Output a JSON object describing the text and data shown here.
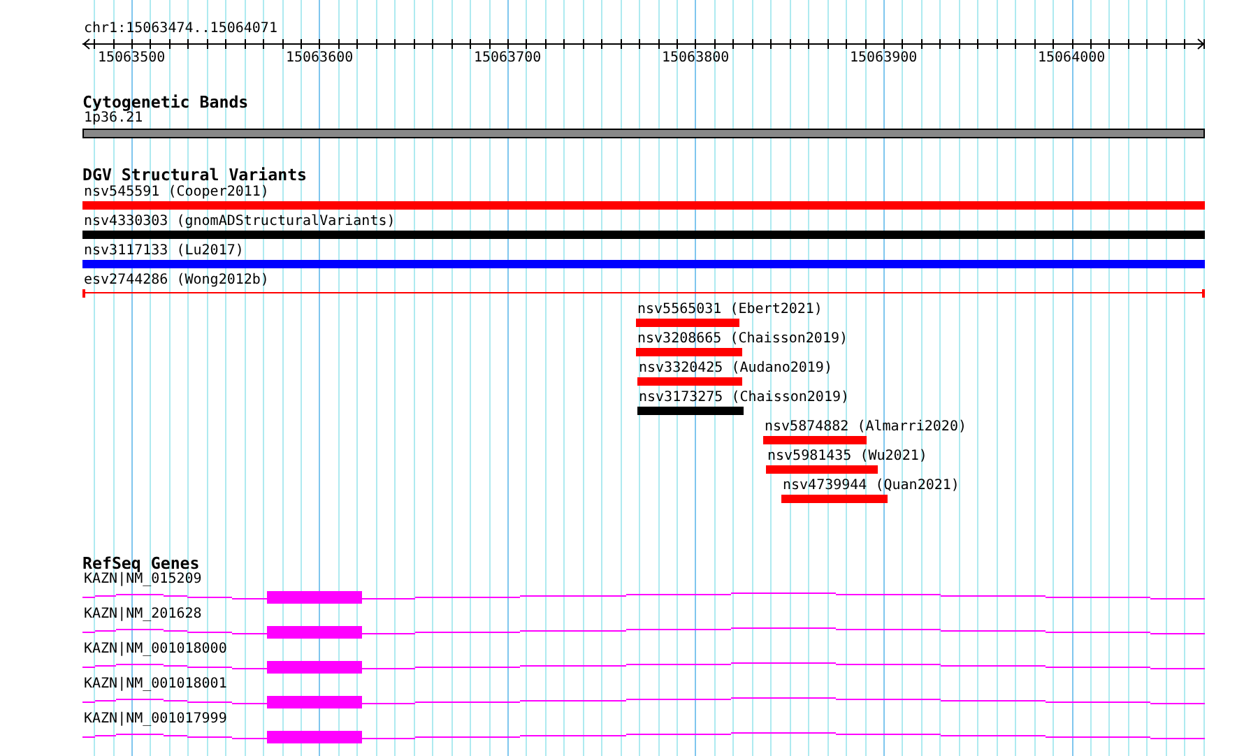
{
  "ruler": {
    "range": "chr1:15063474..15064071",
    "ticks": [
      "15063500",
      "15063600",
      "15063700",
      "15063800",
      "15063900",
      "15064000"
    ]
  },
  "tracks": [
    {
      "kind": "bands",
      "title": "Cytogenetic Bands",
      "features": [
        {
          "label": "1p36.21"
        }
      ]
    },
    {
      "kind": "variants",
      "title": "DGV Structural Variants",
      "features": [
        {
          "label": "nsv545591 (Cooper2011)",
          "kind": "bar",
          "color": "#ff0000"
        },
        {
          "label": "nsv4330303 (gnomADStructuralVariants)",
          "kind": "bar",
          "color": "#000000"
        },
        {
          "label": "nsv3117133 (Lu2017)",
          "kind": "bar",
          "color": "#0000ff"
        },
        {
          "label": "esv2744286 (Wong2012b)",
          "kind": "line",
          "color": "#ff0000"
        },
        {
          "label": "nsv5565031 (Ebert2021)",
          "kind": "bar",
          "color": "#ff0000"
        },
        {
          "label": "nsv3208665 (Chaisson2019)",
          "kind": "bar",
          "color": "#ff0000"
        },
        {
          "label": "nsv3320425 (Audano2019)",
          "kind": "bar",
          "color": "#ff0000"
        },
        {
          "label": "nsv3173275 (Chaisson2019)",
          "kind": "bar",
          "color": "#000000"
        },
        {
          "label": "nsv5874882 (Almarri2020)",
          "kind": "bar",
          "color": "#ff0000"
        },
        {
          "label": "nsv5981435 (Wu2021)",
          "kind": "bar",
          "color": "#ff0000"
        },
        {
          "label": "nsv4739944 (Quan2021)",
          "kind": "bar",
          "color": "#ff0000"
        }
      ]
    },
    {
      "kind": "genes",
      "title": "RefSeq Genes",
      "features": [
        {
          "label": "KAZN|NM_015209"
        },
        {
          "label": "KAZN|NM_201628"
        },
        {
          "label": "KAZN|NM_001018000"
        },
        {
          "label": "KAZN|NM_001018001"
        },
        {
          "label": "KAZN|NM_001017999"
        }
      ]
    }
  ]
}
